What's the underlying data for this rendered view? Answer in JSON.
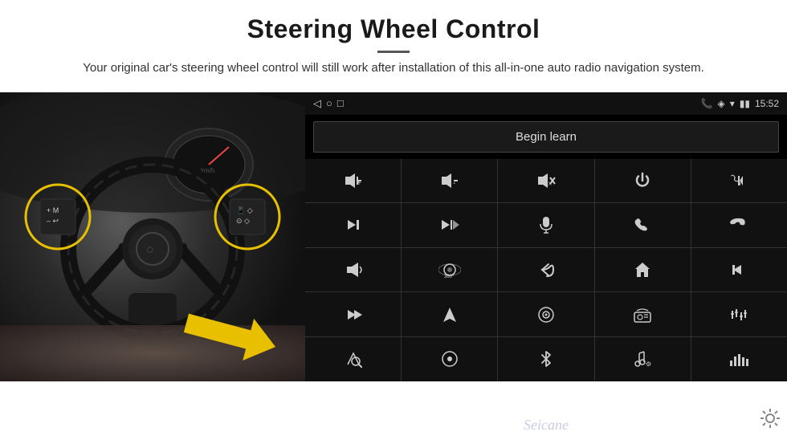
{
  "header": {
    "title": "Steering Wheel Control",
    "subtitle": "Your original car's steering wheel control will still work after installation of this all-in-one auto radio navigation system."
  },
  "status_bar": {
    "time": "15:52",
    "icons": [
      "◁",
      "○",
      "□"
    ]
  },
  "begin_learn_button": "Begin learn",
  "controls": [
    [
      "🔊+",
      "🔊–",
      "🔇",
      "⏻",
      "📞⏮"
    ],
    [
      "⏭",
      "⏭⏮",
      "🎤",
      "📞",
      "↩"
    ],
    [
      "🔔",
      "360°",
      "↩",
      "🏠",
      "⏮⏮"
    ],
    [
      "⏭⏭",
      "▶",
      "⏺",
      "📻",
      "⚙"
    ],
    [
      "🎤",
      "⏺",
      "✱",
      "🎵",
      "📊"
    ]
  ],
  "controls_unicode": [
    [
      "🔊+",
      "🔊-",
      "🔇",
      "⏻",
      "⏮"
    ],
    [
      "⏭",
      "⏭|⏮",
      "🎙",
      "📞",
      "↩"
    ],
    [
      "🔔",
      "360",
      "↺",
      "⌂",
      "⏮"
    ],
    [
      "⏭",
      "▶",
      "⏺",
      "📻",
      "≡"
    ],
    [
      "✎",
      "⏺",
      "✱",
      "♪",
      "📶"
    ]
  ],
  "watermark": "Seicane",
  "icons": {
    "vol_up": "🔊+",
    "vol_down": "🔉-",
    "mute": "🔇",
    "power": "⏻",
    "prev_track": "⏮",
    "next_track": "⏭",
    "mic": "🎙",
    "phone": "📞",
    "hang_up": "↩",
    "horn": "📣",
    "cam360": "360°",
    "back": "↺",
    "home": "⌂",
    "rewind": "⏮",
    "fast_forward": "⏭",
    "nav": "▶",
    "source": "⏺",
    "radio": "📻",
    "eq": "≡",
    "voice": "✎",
    "settings_btn": "⏺",
    "bluetooth": "✱",
    "music": "♪",
    "spectrum": "📶",
    "gear": "⚙"
  }
}
